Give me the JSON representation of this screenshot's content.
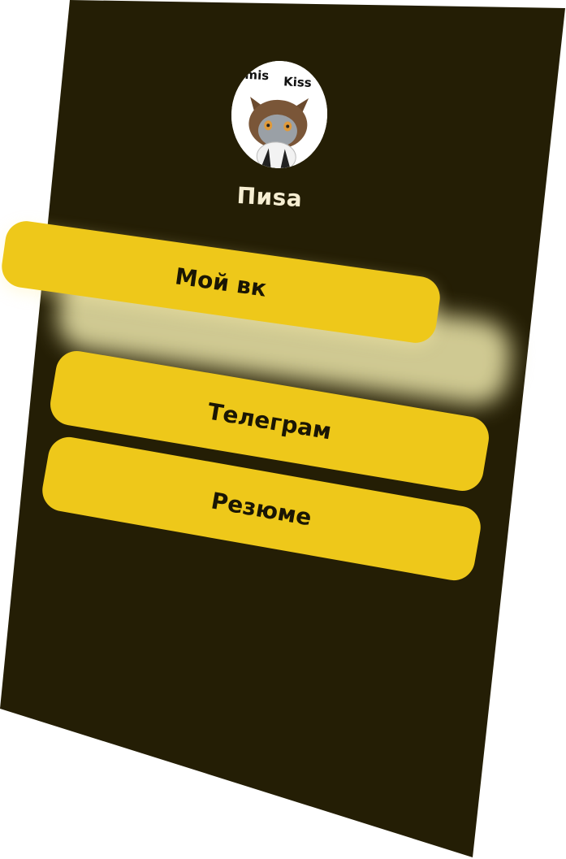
{
  "profile": {
    "name": "Пиsa",
    "avatar_icon": "cat-avatar-icon",
    "avatar_caption_left": "mis",
    "avatar_caption_right": "Kiss"
  },
  "links": {
    "vk_label": "Мой вк",
    "telegram_label": "Телеграм",
    "resume_label": "Резюме"
  },
  "colors": {
    "background": "#241e05",
    "button": "#eec81a",
    "button_text": "#1a1604",
    "title_text": "#f6eed2",
    "glow": "#d9d39a"
  }
}
